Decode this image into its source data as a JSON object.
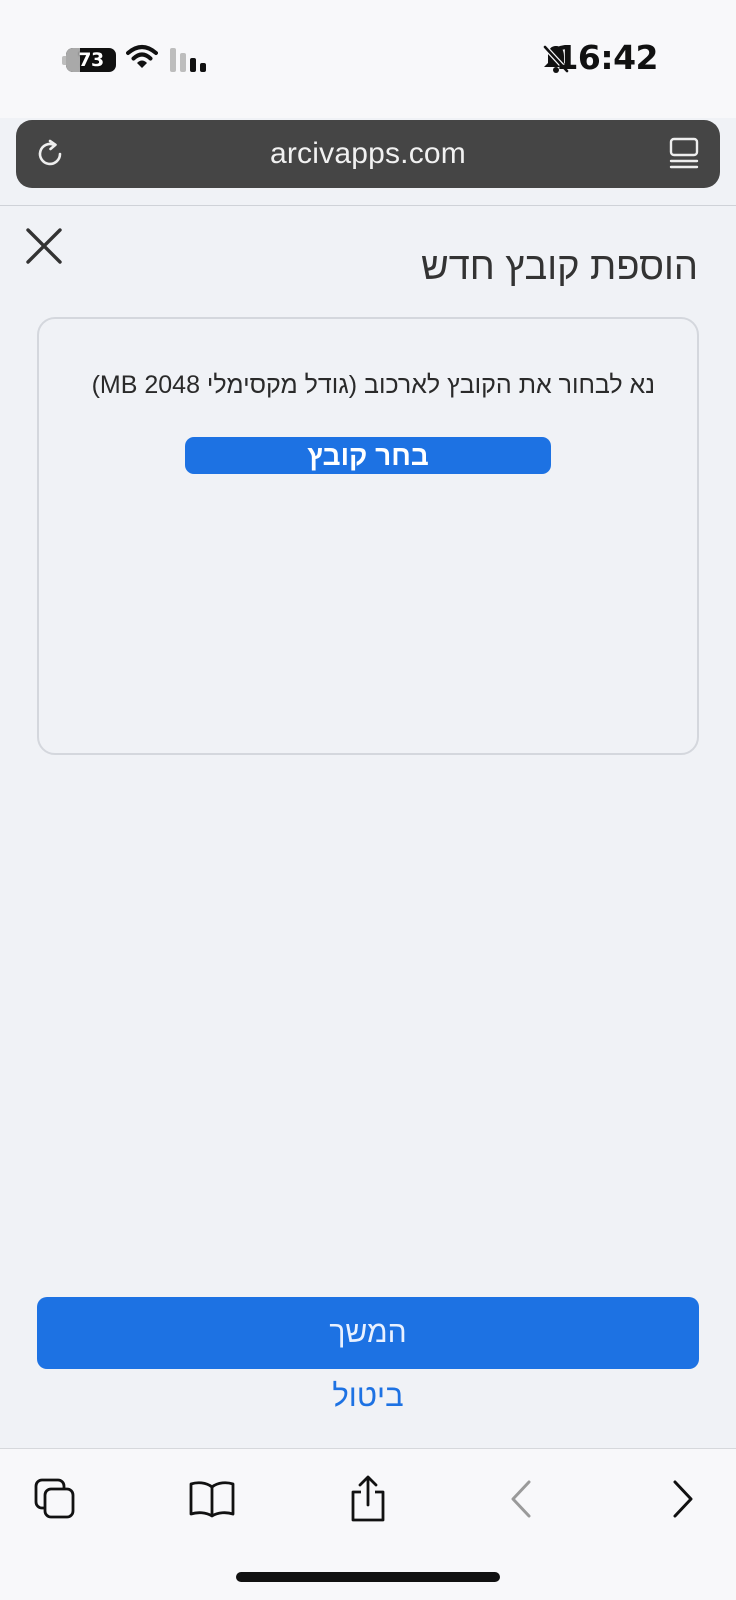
{
  "status_bar": {
    "battery_level": "73",
    "time": "16:42",
    "icons": [
      "battery-icon",
      "wifi-icon",
      "cellular-signal-icon",
      "bell-slash-icon"
    ]
  },
  "browser": {
    "url": "arcivapps.com",
    "icons": [
      "reload-icon",
      "reader-mode-icon"
    ]
  },
  "dialog": {
    "title": "הוספת קובץ חדש",
    "hint": "נא לבחור את הקובץ לארכוב (גודל מקסימלי MB 2048)",
    "choose_file_label": "בחר קובץ",
    "continue_label": "המשך",
    "cancel_label": "ביטול"
  },
  "toolbar": {
    "icons": [
      "tabs-icon",
      "bookmarks-icon",
      "share-icon",
      "back-icon",
      "forward-icon"
    ]
  },
  "colors": {
    "accent": "#1d72e3",
    "background": "#f0f2f6",
    "url_bar": "#454545"
  }
}
